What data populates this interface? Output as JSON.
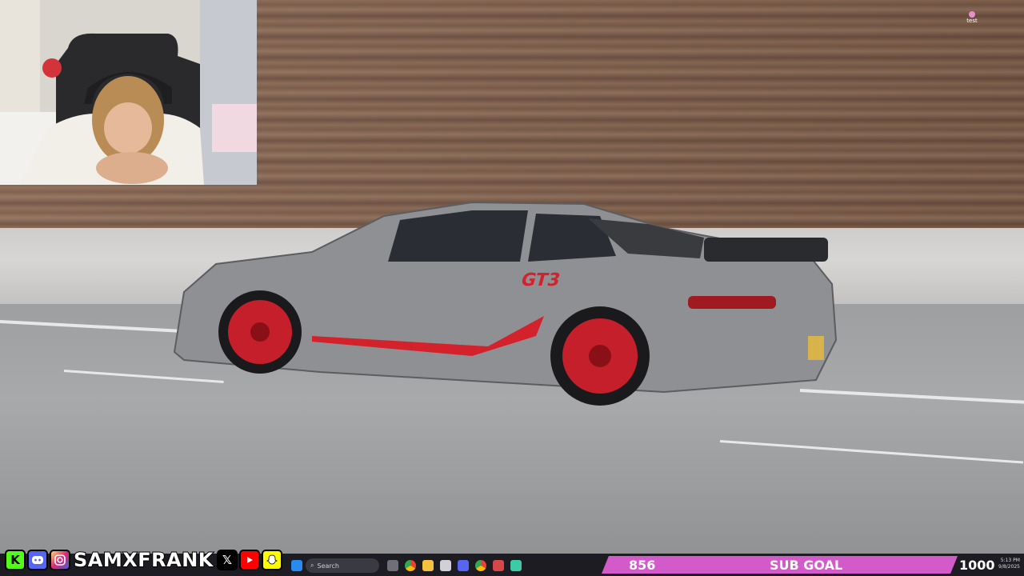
{
  "overlay": {
    "corner_label": "test"
  },
  "socials": {
    "handle": "SAMXFRANK",
    "icons": [
      "kick-icon",
      "discord-icon",
      "instagram-icon",
      "x-icon",
      "youtube-icon",
      "snapchat-icon"
    ],
    "colors": {
      "kick": "#53fc18",
      "discord": "#5865f2",
      "instagram": "#d62976",
      "x": "#000000",
      "youtube": "#ff0000",
      "snapchat": "#fffc00"
    }
  },
  "taskbar": {
    "search_label": "Search",
    "time": "5:13 PM",
    "date": "9/8/2025"
  },
  "sub_goal": {
    "current": "856",
    "label": "SUB GOAL",
    "target": "1000",
    "progress": 0.856,
    "color": "#d35ac9"
  },
  "car": {
    "badge": "GT3",
    "accent": "#d3222c",
    "body": "#8e9093"
  }
}
